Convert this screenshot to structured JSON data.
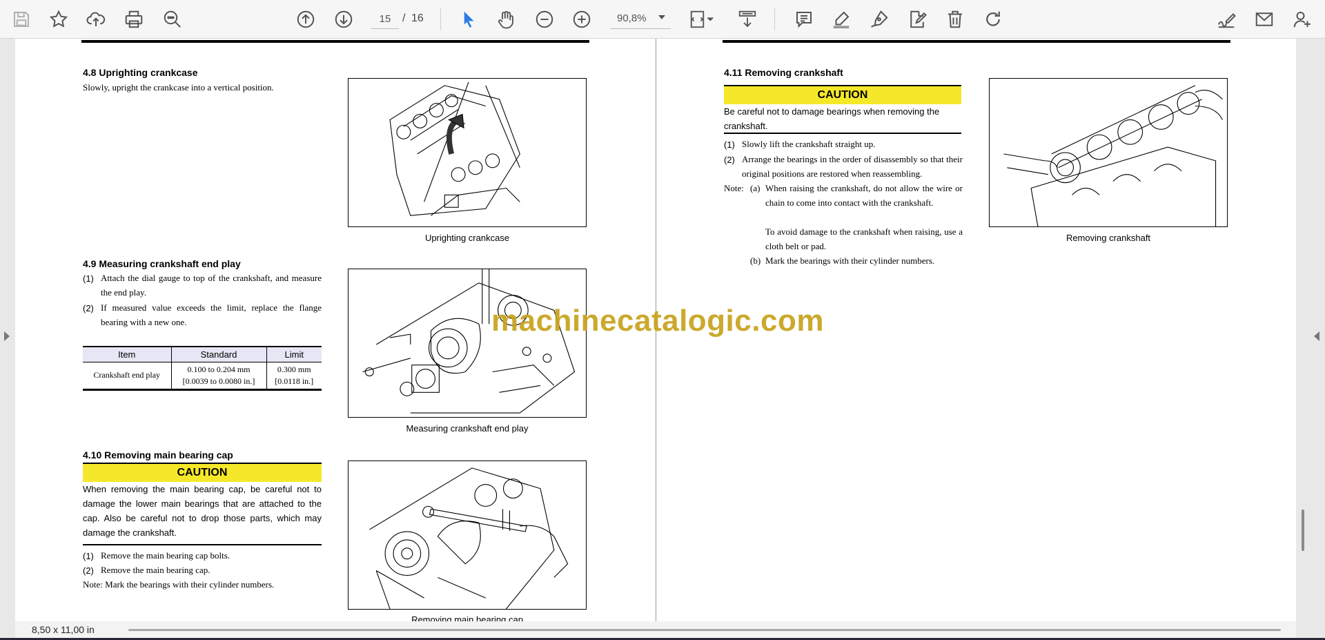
{
  "toolbar": {
    "current_page": "15",
    "page_separator": "/",
    "total_pages": "16",
    "zoom": "90,8%"
  },
  "status": {
    "page_size": "8,50 x 11,00 in"
  },
  "watermark": "machinecatalogic.com",
  "left_page": {
    "s48": {
      "heading": "4.8   Uprighting crankcase",
      "text": "Slowly, upright the crankcase into a vertical position.",
      "caption": "Uprighting crankcase"
    },
    "s49": {
      "heading": "4.9   Measuring crankshaft end play",
      "steps": [
        {
          "num": "(1)",
          "text": "Attach the dial gauge to top of the crankshaft, and measure the end play."
        },
        {
          "num": "(2)",
          "text": "If measured value exceeds the limit, replace the flange bearing with a new one."
        }
      ],
      "table": {
        "headers": [
          "Item",
          "Standard",
          "Limit"
        ],
        "rows": [
          {
            "item": "Crankshaft end play",
            "standard_1": "0.100 to 0.204 mm",
            "standard_2": "[0.0039 to 0.0080 in.]",
            "limit_1": "0.300 mm",
            "limit_2": "[0.0118 in.]"
          }
        ]
      },
      "caption": "Measuring crankshaft end play"
    },
    "s410": {
      "heading": "4.10 Removing main bearing cap",
      "caution_label": "CAUTION",
      "caution_text": "When removing the main bearing cap, be careful not to damage the lower main bearings that are attached to the cap. Also be careful not to drop those parts, which may damage the crankshaft.",
      "steps": [
        {
          "num": "(1)",
          "text": "Remove the main bearing cap bolts."
        },
        {
          "num": "(2)",
          "text": "Remove the main bearing cap."
        }
      ],
      "note": "Note: Mark the bearings with their cylinder numbers.",
      "caption": "Removing main bearing cap"
    }
  },
  "right_page": {
    "s411": {
      "heading": "4.11 Removing crankshaft",
      "caution_label": "CAUTION",
      "caution_text": "Be careful not to damage bearings when removing the crankshaft.",
      "steps": [
        {
          "num": "(1)",
          "text": "Slowly lift the crankshaft straight up."
        },
        {
          "num": "(2)",
          "text": "Arrange the bearings in the order of disassembly so that their original positions are restored when reassembling."
        }
      ],
      "note_label": "Note:",
      "note_a_label": "(a)",
      "note_a_text": "When raising the crankshaft, do not allow the wire or chain to come into contact with the crankshaft.",
      "note_a_text2": "To avoid damage to the crankshaft when raising, use a cloth belt or pad.",
      "note_b_label": "(b)",
      "note_b_text": "Mark the bearings with their cylinder numbers.",
      "caption": "Removing crankshaft"
    }
  },
  "icons": {
    "save": "save-icon",
    "bookmark": "star-icon",
    "upload": "cloud-upload-icon",
    "print": "print-icon",
    "find": "zoom-search-icon",
    "prev": "arrow-up-circle-icon",
    "next": "arrow-down-circle-icon",
    "select": "cursor-icon",
    "hand": "hand-icon",
    "zoom_out": "minus-circle-icon",
    "zoom_in": "plus-circle-icon",
    "fit": "page-fit-icon",
    "scroll": "scroll-mode-icon",
    "comment": "comment-icon",
    "highlight": "highlighter-icon",
    "draw": "pen-icon",
    "edit": "document-edit-icon",
    "delete": "trash-icon",
    "redo": "redo-icon",
    "sign": "sign-icon",
    "mail": "mail-icon",
    "account": "account-icon"
  },
  "colors": {
    "accent": "#2d7be5",
    "caution": "#f5e82a",
    "icon": "#555555",
    "watermark": "#c7a21c"
  }
}
